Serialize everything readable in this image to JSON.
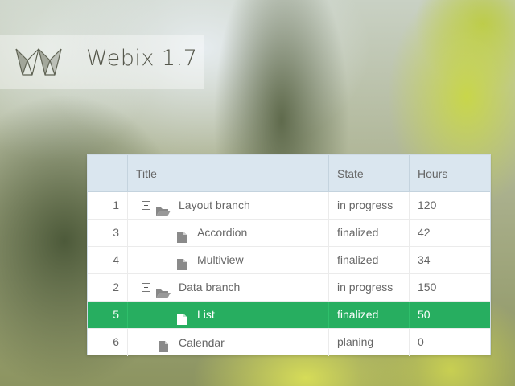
{
  "app": {
    "title": "Webix 1.7"
  },
  "grid": {
    "columns": [
      "",
      "Title",
      "State",
      "Hours"
    ],
    "rows": [
      {
        "id": "1",
        "title": "Layout branch",
        "state": "in progress",
        "hours": "120",
        "type": "folder",
        "expanded": true,
        "level": 1,
        "selected": false
      },
      {
        "id": "3",
        "title": "Accordion",
        "state": "finalized",
        "hours": "42",
        "type": "file",
        "level": 2,
        "selected": false
      },
      {
        "id": "4",
        "title": "Multiview",
        "state": "finalized",
        "hours": "34",
        "type": "file",
        "level": 2,
        "selected": false
      },
      {
        "id": "2",
        "title": "Data branch",
        "state": "in progress",
        "hours": "150",
        "type": "folder",
        "expanded": true,
        "level": 1,
        "selected": false
      },
      {
        "id": "5",
        "title": "List",
        "state": "finalized",
        "hours": "50",
        "type": "file",
        "level": 2,
        "selected": true
      },
      {
        "id": "6",
        "title": "Calendar",
        "state": "planing",
        "hours": "0",
        "type": "file",
        "level": 1,
        "selected": false
      }
    ]
  },
  "colors": {
    "selected_row": "#27ae60",
    "header_bg": "#dae6ef"
  },
  "icons": {
    "logo": "webix-logo",
    "toggle": "minus-square-icon",
    "folder": "folder-open-icon",
    "file": "file-icon"
  }
}
